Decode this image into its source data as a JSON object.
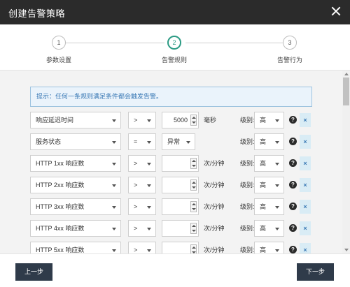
{
  "dialog": {
    "title": "创建告警策略"
  },
  "steps": [
    {
      "number": "1",
      "label": "参数设置"
    },
    {
      "number": "2",
      "label": "告警规则"
    },
    {
      "number": "3",
      "label": "告警行为"
    }
  ],
  "hint": "提示：任何一条规则满足条件都会触发告警。",
  "rules": [
    {
      "metric": "响应延迟时间",
      "operator": ">",
      "value": "5000",
      "unit": "毫秒",
      "level_label": "级别:",
      "level": "高"
    },
    {
      "metric": "服务状态",
      "operator": "=",
      "value": "异常",
      "unit": "",
      "level_label": "级别:",
      "level": "高"
    },
    {
      "metric": "HTTP 1xx 响应数",
      "operator": ">",
      "value": "",
      "unit": "次/分钟",
      "level_label": "级别:",
      "level": "高"
    },
    {
      "metric": "HTTP 2xx 响应数",
      "operator": ">",
      "value": "",
      "unit": "次/分钟",
      "level_label": "级别:",
      "level": "高"
    },
    {
      "metric": "HTTP 3xx 响应数",
      "operator": ">",
      "value": "",
      "unit": "次/分钟",
      "level_label": "级别:",
      "level": "高"
    },
    {
      "metric": "HTTP 4xx 响应数",
      "operator": ">",
      "value": "",
      "unit": "次/分钟",
      "level_label": "级别:",
      "level": "高"
    },
    {
      "metric": "HTTP 5xx 响应数",
      "operator": ">",
      "value": "",
      "unit": "次/分钟",
      "level_label": "级别:",
      "level": "高"
    }
  ],
  "icons": {
    "help": "?",
    "delete": "×"
  },
  "footer": {
    "prev_label": "上一步",
    "next_label": "下一步"
  },
  "colors": {
    "titlebar": "#2b2b2b",
    "active_step": "#2c9b84",
    "hint_text": "#3a79b5",
    "button": "#2f3b4a"
  }
}
